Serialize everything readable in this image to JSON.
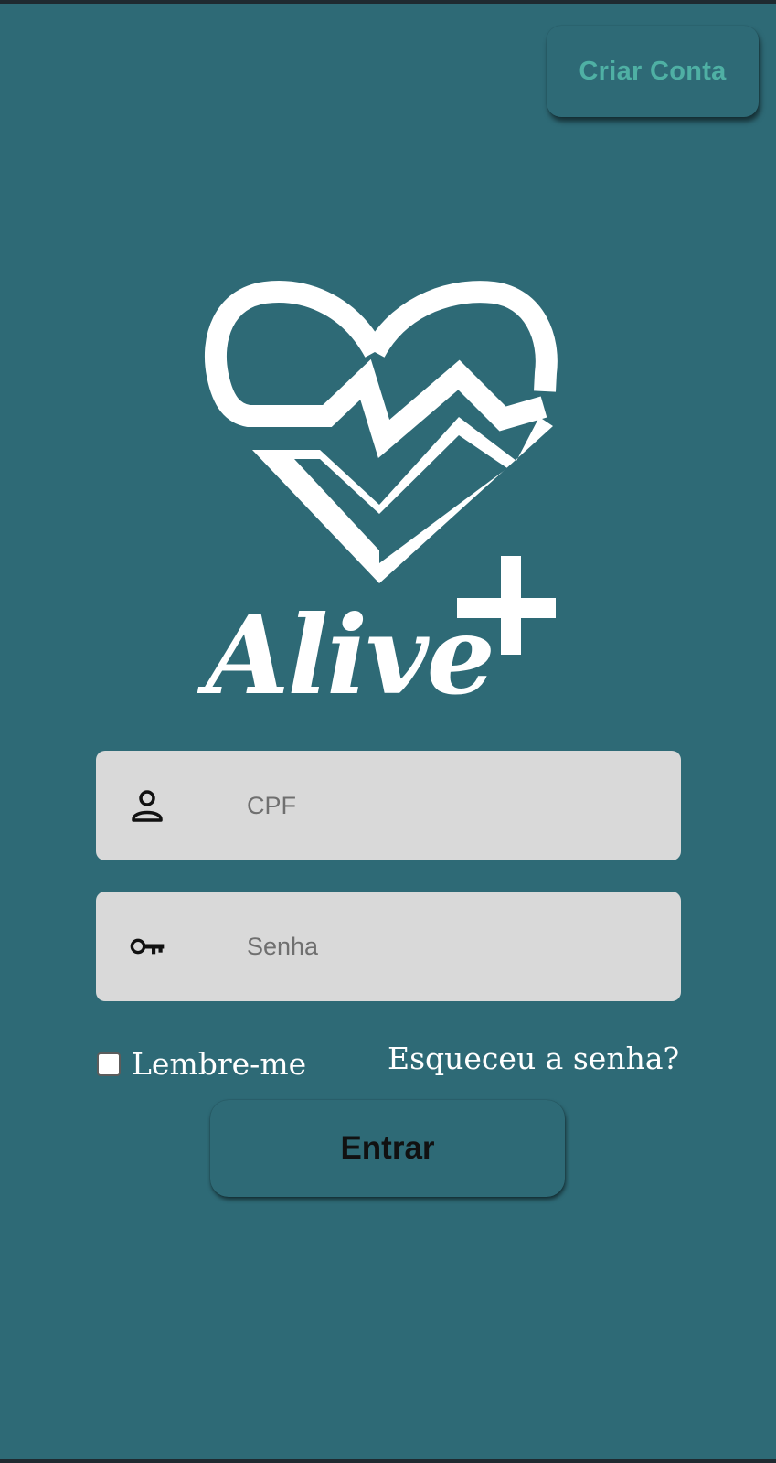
{
  "header": {
    "create_account_label": "Criar Conta"
  },
  "logo": {
    "icon": "heart-pulse-plus-icon",
    "text": "Alive"
  },
  "form": {
    "cpf": {
      "icon": "user-icon",
      "placeholder": "CPF",
      "value": ""
    },
    "password": {
      "icon": "key-icon",
      "placeholder": "Senha",
      "value": ""
    },
    "remember_label": "Lembre-me",
    "remember_checked": false,
    "forgot_label": "Esqueceu a senha?",
    "submit_label": "Entrar"
  },
  "colors": {
    "background": "#2e6a76",
    "accent_text": "#4fb0a4",
    "field_bg": "#d9d9d9",
    "logo": "#ffffff"
  }
}
